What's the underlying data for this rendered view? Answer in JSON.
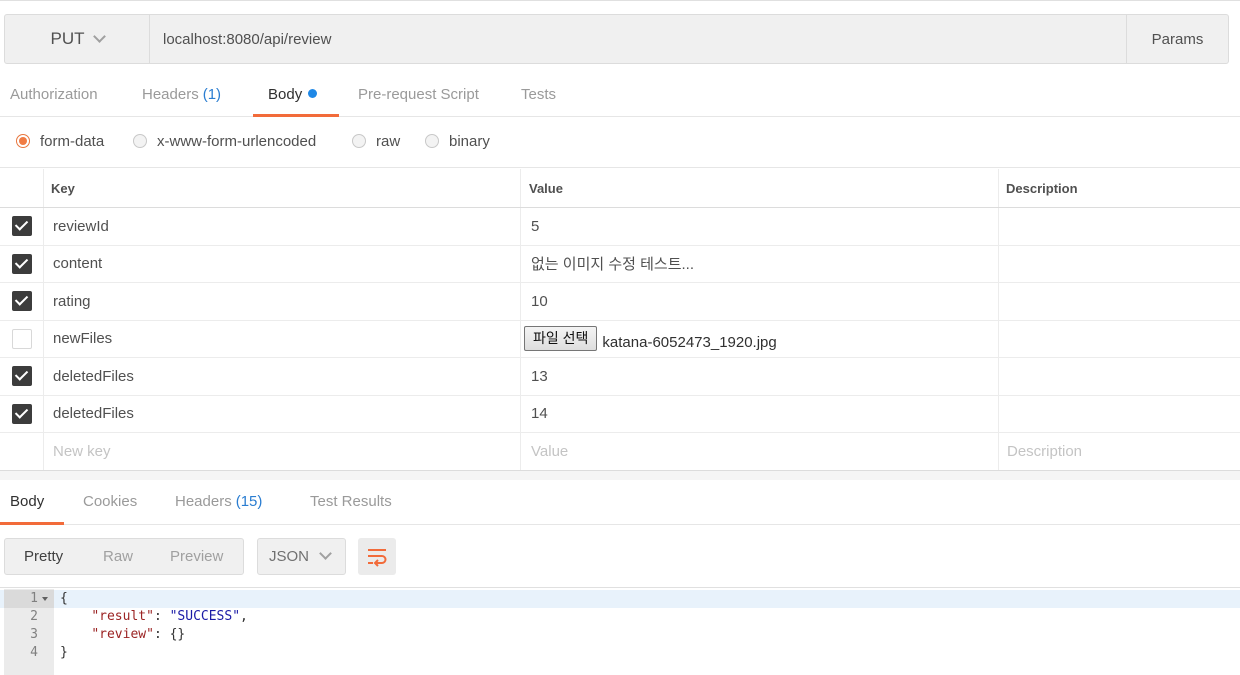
{
  "request": {
    "method": "PUT",
    "url": "localhost:8080/api/review",
    "params_label": "Params"
  },
  "request_tabs": {
    "authorization": "Authorization",
    "headers": "Headers",
    "headers_count": "(1)",
    "body": "Body",
    "prerequest": "Pre-request Script",
    "tests": "Tests",
    "active": "Body"
  },
  "body_types": {
    "form_data": "form-data",
    "urlencoded": "x-www-form-urlencoded",
    "raw": "raw",
    "binary": "binary",
    "selected": "form-data"
  },
  "form_table": {
    "columns": {
      "key": "Key",
      "value": "Value",
      "description": "Description"
    },
    "rows": [
      {
        "checked": true,
        "key": "reviewId",
        "value": "5",
        "description": ""
      },
      {
        "checked": true,
        "key": "content",
        "value": "없는 이미지 수정 테스트...",
        "description": ""
      },
      {
        "checked": true,
        "key": "rating",
        "value": "10",
        "description": ""
      },
      {
        "checked": false,
        "key": "newFiles",
        "file_button": "파일 선택",
        "file_name": "katana-6052473_1920.jpg",
        "description": ""
      },
      {
        "checked": true,
        "key": "deletedFiles",
        "value": "13",
        "description": ""
      },
      {
        "checked": true,
        "key": "deletedFiles",
        "value": "14",
        "description": ""
      }
    ],
    "placeholders": {
      "key": "New key",
      "value": "Value",
      "description": "Description"
    }
  },
  "response_tabs": {
    "body": "Body",
    "cookies": "Cookies",
    "headers": "Headers",
    "headers_count": "(15)",
    "test_results": "Test Results",
    "active": "Body"
  },
  "view_modes": {
    "pretty": "Pretty",
    "raw": "Raw",
    "preview": "Preview",
    "active": "Pretty"
  },
  "format": "JSON",
  "icons": {
    "wrap": "wrap-lines-icon",
    "chevron": "chevron-down-icon",
    "fold": "fold-arrow-icon"
  },
  "colors": {
    "accent": "#f26b3a",
    "link_count": "#2a7dd1",
    "dot": "#1f88e6"
  },
  "response_code": {
    "l1": "1",
    "l2": "2",
    "l3": "3",
    "l4": "4",
    "open_brace": "{",
    "close_brace": "}",
    "k1": "\"result\"",
    "v1": "\"SUCCESS\"",
    "k2": "\"review\"",
    "v2": "{}",
    "colon": ": ",
    "comma": ","
  }
}
